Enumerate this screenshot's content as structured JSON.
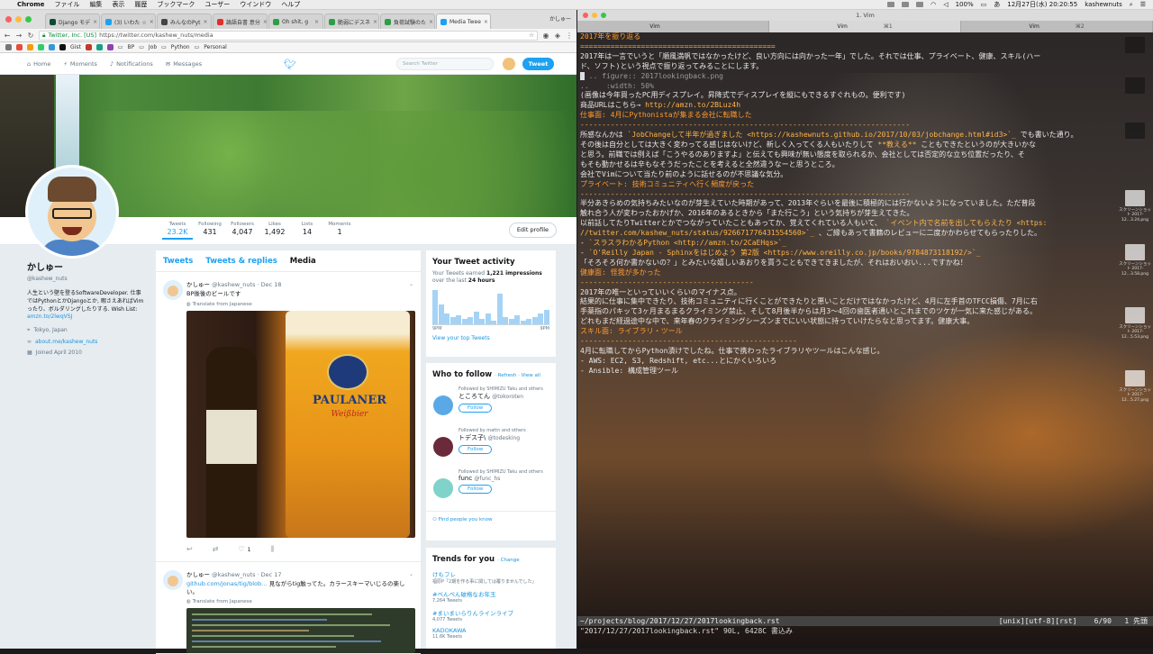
{
  "menubar": {
    "app": "Chrome",
    "items": [
      "ファイル",
      "編集",
      "表示",
      "履歴",
      "ブックマーク",
      "ユーザー",
      "ウインドウ",
      "ヘルプ"
    ],
    "battery": "100%",
    "datetime": "12月27日(水) 20:20:55",
    "user": "kashewnuts"
  },
  "chrome": {
    "tabs": [
      {
        "title": "Django モデ",
        "color": "#0c4b33"
      },
      {
        "title": "(3) いわた ☆",
        "color": "#1da1f2"
      },
      {
        "title": "みんなのPyt",
        "color": "#444444"
      },
      {
        "title": "論語自書 意分",
        "color": "#e52d27"
      },
      {
        "title": "Oh shit, g",
        "color": "#2e9d48"
      },
      {
        "title": "脆弱にデスネ",
        "color": "#2e9d48"
      },
      {
        "title": "負荷試験のた",
        "color": "#2e9d48"
      },
      {
        "title": "Media Twee",
        "color": "#1da1f2",
        "active": true
      }
    ],
    "user_label": "かしゅー",
    "url_company": "Twitter, Inc. [US]",
    "url": "https://twitter.com/kashew_nuts/media",
    "bookmarks": [
      "Gist",
      "BP",
      "Job",
      "Python",
      "Personal"
    ]
  },
  "twitter": {
    "nav": [
      "Home",
      "Moments",
      "Notifications",
      "Messages"
    ],
    "search_placeholder": "Search Twitter",
    "tweet_button": "Tweet",
    "stats": [
      {
        "label": "Tweets",
        "value": "23.2K"
      },
      {
        "label": "Following",
        "value": "431"
      },
      {
        "label": "Followers",
        "value": "4,047"
      },
      {
        "label": "Likes",
        "value": "1,492"
      },
      {
        "label": "Lists",
        "value": "14"
      },
      {
        "label": "Moments",
        "value": "1"
      }
    ],
    "edit_profile": "Edit profile",
    "profile": {
      "name": "かしゅー",
      "handle": "@kashew_nuts",
      "bio": "人生という壁を登るSoftwareDeveloper. 仕事ではPythonとかDjangoとか, 暇さえあればVimったり、ボルダリングしたりする. Wish List:",
      "bio_link": "amzn.to/2lwqVSJ",
      "location": "Tokyo, Japan",
      "site": "about.me/kashew_nuts",
      "joined": "Joined April 2010"
    },
    "timeline_tabs": [
      "Tweets",
      "Tweets & replies",
      "Media"
    ],
    "tweets": [
      {
        "name": "かしゅー",
        "meta": "@kashew_nuts · Dec 18",
        "text": "BP後後のビールです",
        "translate": "Translate from Japanese",
        "likes": "1",
        "photo_brand": "PAULANER",
        "photo_sub": "Weißbier"
      },
      {
        "name": "かしゅー",
        "meta": "@kashew_nuts · Dec 17",
        "text_link": "github.com/jonas/tig/blob…",
        "text": " 見ながらtig触ってた。カラースキーマいじるの楽しい。",
        "translate": "Translate from Japanese"
      }
    ],
    "activity": {
      "title": "Your Tweet activity",
      "line1_pre": "Your Tweets earned ",
      "impressions": "1,221 impressions",
      "line2_pre": "over the last ",
      "period": "24 hours",
      "x_start": "9PM",
      "x_end": "9PM",
      "link": "View your top Tweets",
      "bars": [
        38,
        22,
        12,
        8,
        10,
        6,
        8,
        14,
        6,
        12,
        4,
        34,
        8,
        6,
        10,
        4,
        6,
        8,
        12,
        16
      ]
    },
    "wtf": {
      "title": "Who to follow",
      "refresh": "Refresh",
      "view_all": "View all",
      "people": [
        {
          "followed_by": "Followed by SHIMIZU Taku and others",
          "name": "ところてん",
          "handle": "@tokoroten",
          "color": "#5aa9e6"
        },
        {
          "followed_by": "Followed by mattn and others",
          "name": "トデス子\\",
          "handle": "@todesking",
          "color": "#6b2a3a"
        },
        {
          "followed_by": "Followed by SHIMIZU Taku and others",
          "name": "func",
          "handle": "@func_hs",
          "color": "#7fd3c8"
        }
      ],
      "follow_label": "Follow",
      "find": "Find people you know"
    },
    "trends": {
      "title": "Trends for you",
      "change": "Change",
      "items": [
        {
          "name": "けもフレ",
          "desc": "福原P「2期を作る事に関しては覆りませんでした」"
        },
        {
          "name": "#ぺんぺん破格なお年玉",
          "desc": "7,264 Tweets"
        },
        {
          "name": "#まいまいらりんラインライブ",
          "desc": "4,077 Tweets"
        },
        {
          "name": "KADOKAWA",
          "desc": "11.6K Tweets"
        }
      ]
    }
  },
  "terminal": {
    "title": "1. Vim",
    "tabs": [
      {
        "label": "Vim",
        "key": ""
      },
      {
        "label": "Vim",
        "key": "⌘1",
        "active": true
      },
      {
        "label": "Vim",
        "key": "⌘2"
      }
    ],
    "status_left": "~/projects/blog/2017/12/27/2017lookingback.rst",
    "status_right": "[unix][utf-8][rst]    6/90   1 先頭",
    "cmdline": "\"2017/12/27/2017lookingback.rst\" 90L, 6428C 書込み",
    "desktop_labels": [
      "スクリーンショット 2017-12...3.24.png",
      "スクリーンショット 2017-12...3.58.png",
      "スクリーンショット 2017-12...5.53.png",
      "スクリーンショット 2017-12...5.27.png"
    ],
    "lines": [
      {
        "t": "2017年を振り返る",
        "c": "h"
      },
      {
        "t": "=============================================",
        "c": "u"
      },
      {
        "t": "",
        "c": ""
      },
      {
        "t": "2017年は一言でいうと「順風満帆ではなかったけど、良い方向には向かった一年」でした。それでは仕事、プライベート、健康、スキル(ハー",
        "c": ""
      },
      {
        "t": "ド、ソフト)という視点で振り返ってみることにします。",
        "c": ""
      },
      {
        "t": "",
        "c": ""
      },
      {
        "t": "  .. figure:: 2017lookingback.png",
        "c": "bl",
        "cursor": true
      },
      {
        "t": "..    :width: 50%",
        "c": "bl"
      },
      {
        "t": "",
        "c": ""
      },
      {
        "t": "(画像は今年買ったPC用ディスプレイ。昇降式でディスプレイを縦にもできるすぐれもの。便利です)",
        "c": ""
      },
      {
        "t": "",
        "c": ""
      },
      {
        "t": "商品URLはこちら→ http://amzn.to/2BLuz4h",
        "c": "",
        "hl": "http://amzn.to/2BLuz4h"
      },
      {
        "t": "",
        "c": ""
      },
      {
        "t": "",
        "c": ""
      },
      {
        "t": "仕事面: 4月にPythonistaが集まる会社に転職した",
        "c": "h"
      },
      {
        "t": "----------------------------------------------------------------------------",
        "c": "u"
      },
      {
        "t": "",
        "c": ""
      },
      {
        "t": "所感なんかは `JobChangeして半年が過ぎました <https://kashewnuts.github.io/2017/10/03/jobchange.html#id3>`_ でも書いた通り。",
        "c": "",
        "hl": "`JobChangeして半年が過ぎました <https://kashewnuts.github.io/2017/10/03/jobchange.html#id3>`_"
      },
      {
        "t": "",
        "c": ""
      },
      {
        "t": "その後は自分としては大きく変わってる感じはないけど、新しく入ってくる人もいたりして **教える** こともできたというのが大きいかな",
        "c": "",
        "hl": "**教える**"
      },
      {
        "t": "と思う。前職では例えば「こうやるのありますよ」と伝えても興味が無い態度を取られるか、会社としては否定的な立ち位置だったり、そ",
        "c": ""
      },
      {
        "t": "もそも動かせるは辛もなそうだったことを考えると全然違うなーと思うところ。",
        "c": ""
      },
      {
        "t": "",
        "c": ""
      },
      {
        "t": "会社でVimについて当たり前のように話せるのが不思議な気分。",
        "c": ""
      },
      {
        "t": "",
        "c": ""
      },
      {
        "t": "",
        "c": ""
      },
      {
        "t": "プライベート: 技術コミュニティへ行く頻度が戻った",
        "c": "h"
      },
      {
        "t": "----------------------------------------------------------------------------",
        "c": "u"
      },
      {
        "t": "",
        "c": ""
      },
      {
        "t": "半分あきらめの気持ちみたいなのが芽生えていた時期があって、2013年ぐらいを最後に積極的には行かないようになっていました。ただ普段",
        "c": ""
      },
      {
        "t": "触れ合う人が変わったおかげか、2016年のあるときから「また行こう」という気持ちが芽生えてきた。",
        "c": ""
      },
      {
        "t": "",
        "c": ""
      },
      {
        "t": "以前話してたりTwitterとかでつながっていたこともあってか、覚えてくれている人もいて、 `イベント内で名前を出してもらえたり <https:",
        "c": "",
        "hl": "`イベント内で名前を出してもらえたり <https:"
      },
      {
        "t": "//twitter.com/kashew_nuts/status/926671776431554560>`_ 、ご縁もあって書籍のレビューに二度かかわらせてもらったりした。",
        "c": "",
        "hl": "//twitter.com/kashew_nuts/status/926671776431554560>`_"
      },
      {
        "t": "",
        "c": ""
      },
      {
        "t": "- `スラスラわかるPython <http://amzn.to/2CaEHqs>`_",
        "c": "",
        "hl": "`スラスラわかるPython <http://amzn.to/2CaEHqs>`_"
      },
      {
        "t": "- `O'Reilly Japan - Sphinxをはじめよう 第2版 <https://www.oreilly.co.jp/books/9784873118192/>`_",
        "c": "",
        "hl": "`O'Reilly Japan - Sphinxをはじめよう 第2版 <https://www.oreilly.co.jp/books/9784873118192/>`_"
      },
      {
        "t": "",
        "c": ""
      },
      {
        "t": "「そろそろ何か書かないの？」とみたいな嬉しいあおりを貰うこともできてきましたが、それはおいおい...ですかね！",
        "c": ""
      },
      {
        "t": "",
        "c": ""
      },
      {
        "t": "",
        "c": ""
      },
      {
        "t": "健康面: 怪我が多かった",
        "c": "h"
      },
      {
        "t": "----------------------------------------",
        "c": "u"
      },
      {
        "t": "",
        "c": ""
      },
      {
        "t": "2017年の唯一といっていいくらいのマイナス点。",
        "c": ""
      },
      {
        "t": "",
        "c": ""
      },
      {
        "t": "結果的に仕事に集中できたり、技術コミュニティに行くことができたりと悪いことだけではなかったけど、4月に左手首のTFCC損傷、7月に右",
        "c": ""
      },
      {
        "t": "手薬指のパキッて3ヶ月まるまるクライミング禁止、そして8月後半からは月3〜4回の歯医者通いとこれまでのツケが一気に来た感じがある。",
        "c": ""
      },
      {
        "t": "",
        "c": ""
      },
      {
        "t": "どれもまだ経過途中な中で、来年春のクライミングシーズンまでにいい状態に持っていけたらなと思ってます。健康大事。",
        "c": ""
      },
      {
        "t": "",
        "c": ""
      },
      {
        "t": "",
        "c": ""
      },
      {
        "t": "スキル面: ライブラリ・ツール",
        "c": "h"
      },
      {
        "t": "--------------------------------------------------",
        "c": "u"
      },
      {
        "t": "",
        "c": ""
      },
      {
        "t": "4月に転職してからPython漬けでしたね。仕事で携わったライブラリやツールはこんな感じ。",
        "c": ""
      },
      {
        "t": "",
        "c": ""
      },
      {
        "t": "- AWS: EC2, S3, Redshift, etc...とにかくいろいろ",
        "c": ""
      },
      {
        "t": "- Ansible: 構成管理ツール",
        "c": ""
      }
    ]
  }
}
